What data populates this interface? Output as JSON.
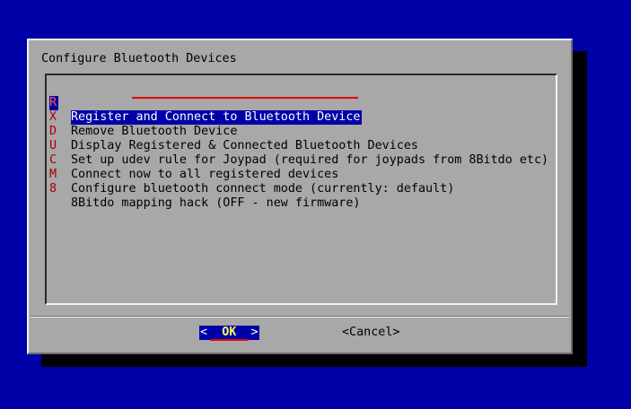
{
  "dialog": {
    "title": "Configure Bluetooth Devices",
    "items": [
      {
        "tag": "R",
        "label": "Register and Connect to Bluetooth Device",
        "selected": true
      },
      {
        "tag": "X",
        "label": "Remove Bluetooth Device"
      },
      {
        "tag": "D",
        "label": "Display Registered & Connected Bluetooth Devices"
      },
      {
        "tag": "U",
        "label": "Set up udev rule for Joypad (required for joypads from 8Bitdo etc)"
      },
      {
        "tag": "C",
        "label": "Connect now to all registered devices"
      },
      {
        "tag": "M",
        "label": "Configure bluetooth connect mode (currently: default)"
      },
      {
        "tag": "8",
        "label": "8Bitdo mapping hack (OFF - new firmware)"
      }
    ],
    "buttons": {
      "ok_left": "<",
      "ok_label": "OK",
      "ok_right": ">",
      "cancel_label": "<Cancel>"
    }
  },
  "colors": {
    "background": "#0000a8",
    "dialog": "#a8a8a8",
    "tag": "#a80000",
    "highlight": "#0000a8",
    "underline": "#e00000"
  }
}
